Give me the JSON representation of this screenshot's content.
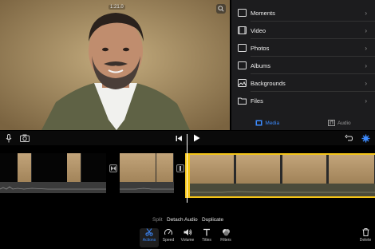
{
  "preview": {
    "timecode": "1:21.0"
  },
  "browser": {
    "items": [
      {
        "label": "Moments",
        "icon": "moments-icon"
      },
      {
        "label": "Video",
        "icon": "video-icon"
      },
      {
        "label": "Photos",
        "icon": "photos-icon"
      },
      {
        "label": "Albums",
        "icon": "albums-icon"
      },
      {
        "label": "Backgrounds",
        "icon": "backgrounds-icon"
      },
      {
        "label": "Files",
        "icon": "files-icon"
      }
    ],
    "tabs": {
      "media": "Media",
      "audio": "Audio"
    }
  },
  "actions": {
    "split": "Split",
    "detach_audio": "Detach Audio",
    "duplicate": "Duplicate"
  },
  "tools": {
    "actions": "Actions",
    "speed": "Speed",
    "volume": "Volume",
    "titles": "Titles",
    "filters": "Filters",
    "delete": "Delete"
  },
  "colors": {
    "accent": "#3d8bff",
    "selection": "#f5c518"
  }
}
